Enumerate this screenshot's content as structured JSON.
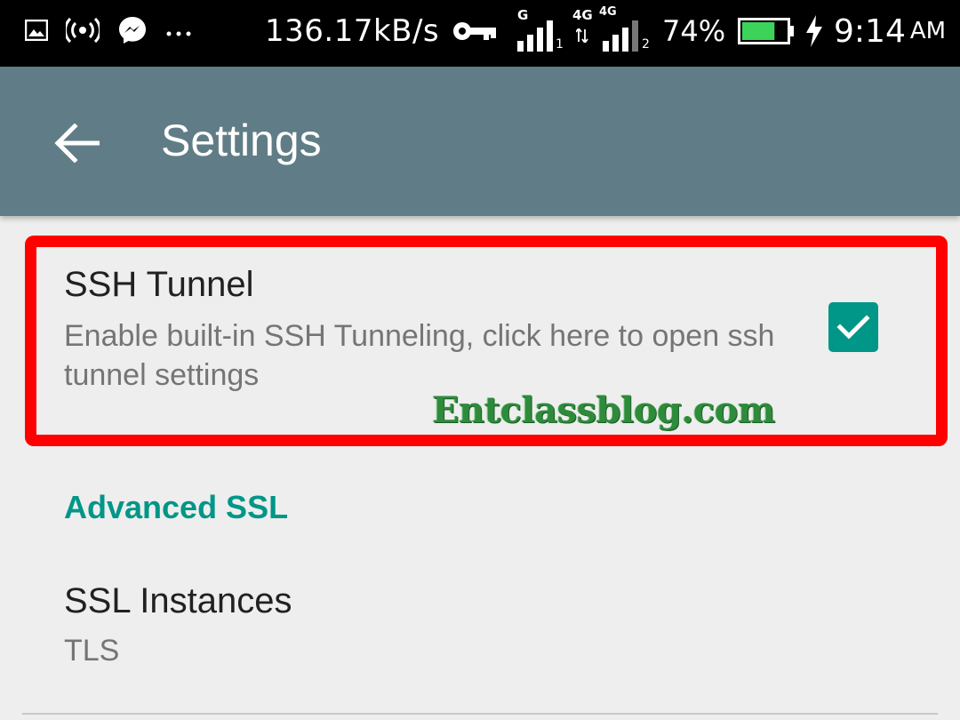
{
  "status_bar": {
    "network_speed": "136.17kB/s",
    "sim1_network": "G",
    "sim1_index": "1",
    "sim2_network_a": "4G",
    "sim2_network_b": "4G",
    "sim2_index": "2",
    "battery_percent": "74%",
    "battery_level": 0.74,
    "time": "9:14",
    "ampm": "AM"
  },
  "app_bar": {
    "title": "Settings",
    "color": "#607d87"
  },
  "preferences": {
    "ssh_tunnel": {
      "title": "SSH Tunnel",
      "summary": "Enable built-in SSH Tunneling, click here to open ssh tunnel settings",
      "checked": true
    },
    "advanced_ssl_header": "Advanced SSL",
    "ssl_instances": {
      "title": "SSL Instances",
      "summary": "TLS"
    }
  },
  "watermark": "Entclassblog.com",
  "colors": {
    "accent": "#009688",
    "highlight": "#ff0000",
    "background": "#eeeeee"
  },
  "icons": [
    "image-icon",
    "hotspot-icon",
    "messenger-icon",
    "more-icon",
    "vpn-key-icon",
    "signal-icon",
    "battery-icon",
    "charging-icon",
    "back-arrow-icon",
    "check-icon"
  ]
}
